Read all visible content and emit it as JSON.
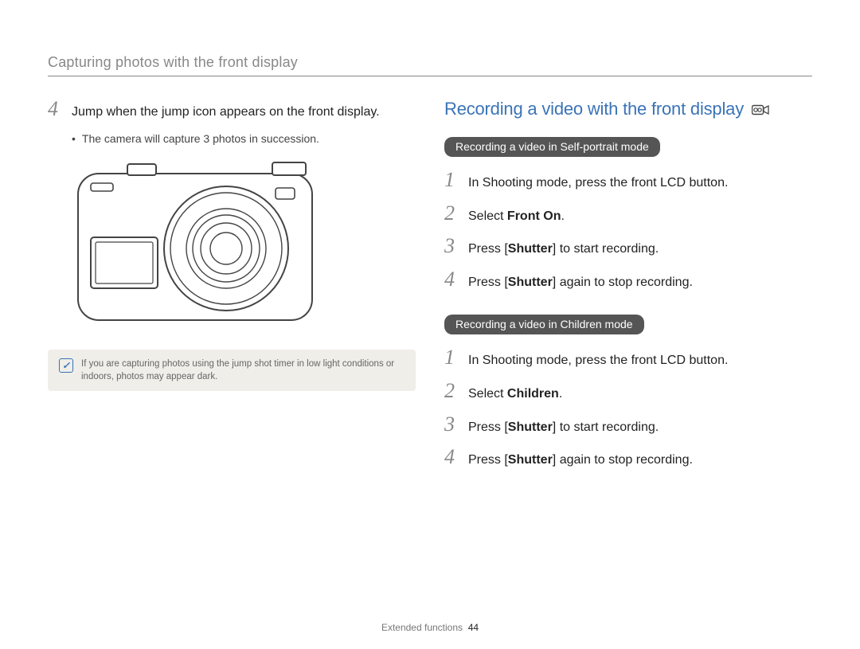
{
  "header": {
    "title": "Capturing photos with the front display"
  },
  "left": {
    "step4": {
      "num": "4",
      "text": "Jump when the jump icon appears on the front display."
    },
    "sub": "The camera will capture 3 photos in succession.",
    "note": "If you are capturing photos using the jump shot timer in low light conditions or indoors, photos may appear dark."
  },
  "right": {
    "heading": "Recording a video with the front display",
    "sectionA": {
      "pill": "Recording a video in Self-portrait mode",
      "steps": {
        "s1": {
          "num": "1",
          "text": "In Shooting mode, press the front LCD button."
        },
        "s2": {
          "num": "2",
          "pre": "Select ",
          "bold": "Front On",
          "post": "."
        },
        "s3": {
          "num": "3",
          "pre": "Press [",
          "bold": "Shutter",
          "post": "] to start recording."
        },
        "s4": {
          "num": "4",
          "pre": "Press [",
          "bold": "Shutter",
          "post": "] again to stop recording."
        }
      }
    },
    "sectionB": {
      "pill": "Recording a video in Children mode",
      "steps": {
        "s1": {
          "num": "1",
          "text": "In Shooting mode, press the front LCD button."
        },
        "s2": {
          "num": "2",
          "pre": "Select ",
          "bold": "Children",
          "post": "."
        },
        "s3": {
          "num": "3",
          "pre": "Press [",
          "bold": "Shutter",
          "post": "] to start recording."
        },
        "s4": {
          "num": "4",
          "pre": "Press [",
          "bold": "Shutter",
          "post": "] again to stop recording."
        }
      }
    }
  },
  "footer": {
    "label": "Extended functions",
    "page": "44"
  }
}
